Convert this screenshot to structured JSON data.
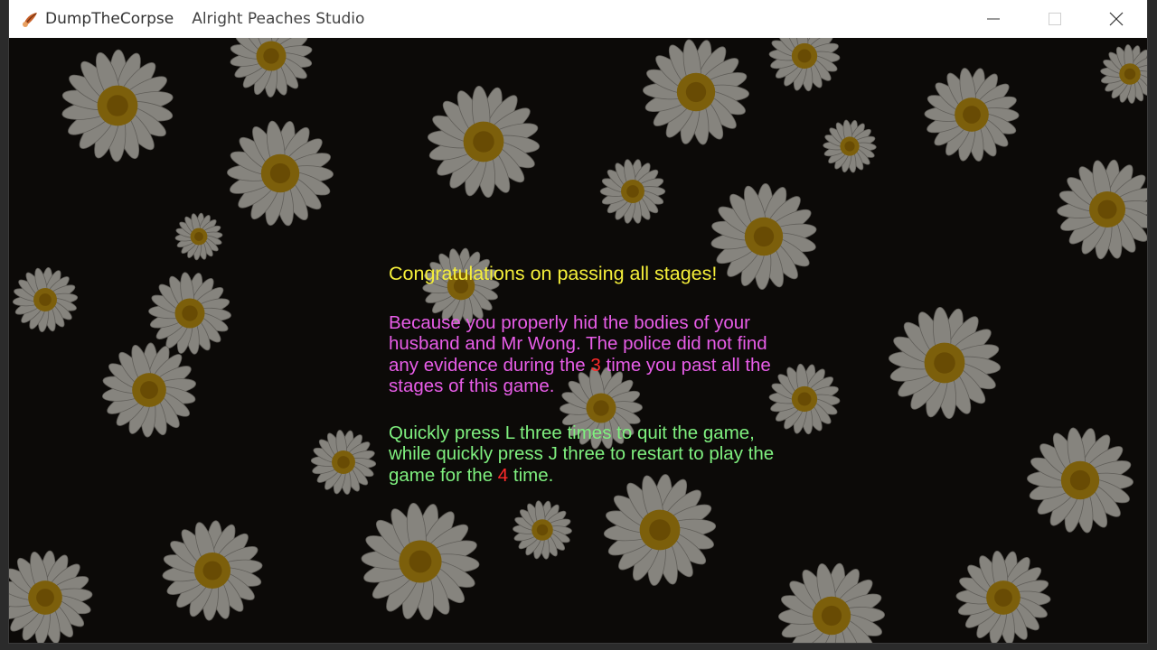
{
  "window": {
    "title": "DumpTheCorpse",
    "studio": "Alright Peaches Studio",
    "icon": "peach-icon"
  },
  "controls": {
    "minimize": "minimize-icon",
    "maximize": "maximize-icon",
    "close": "close-icon"
  },
  "background": {
    "theme": "daisy-flowers",
    "colors": {
      "petal": "#d9d6cc",
      "center": "#c89a12",
      "dark": "#14110d"
    }
  },
  "message": {
    "congrats": "Congratulations on passing all stages!",
    "body_before": "Because you properly hid the bodies of your husband and Mr Wong. The police did not find any evidence during the ",
    "body_count": "3",
    "body_after": "  time you past all the stages of this game.",
    "help_before": "Quickly press L three times to quit the game, while quickly press J three to restart to play the game for the ",
    "help_count": "4",
    "help_after": " time.",
    "colors": {
      "congrats": "#f5ef3a",
      "body": "#e85de8",
      "help": "#7ff07f",
      "count": "#ff2a2a"
    }
  }
}
